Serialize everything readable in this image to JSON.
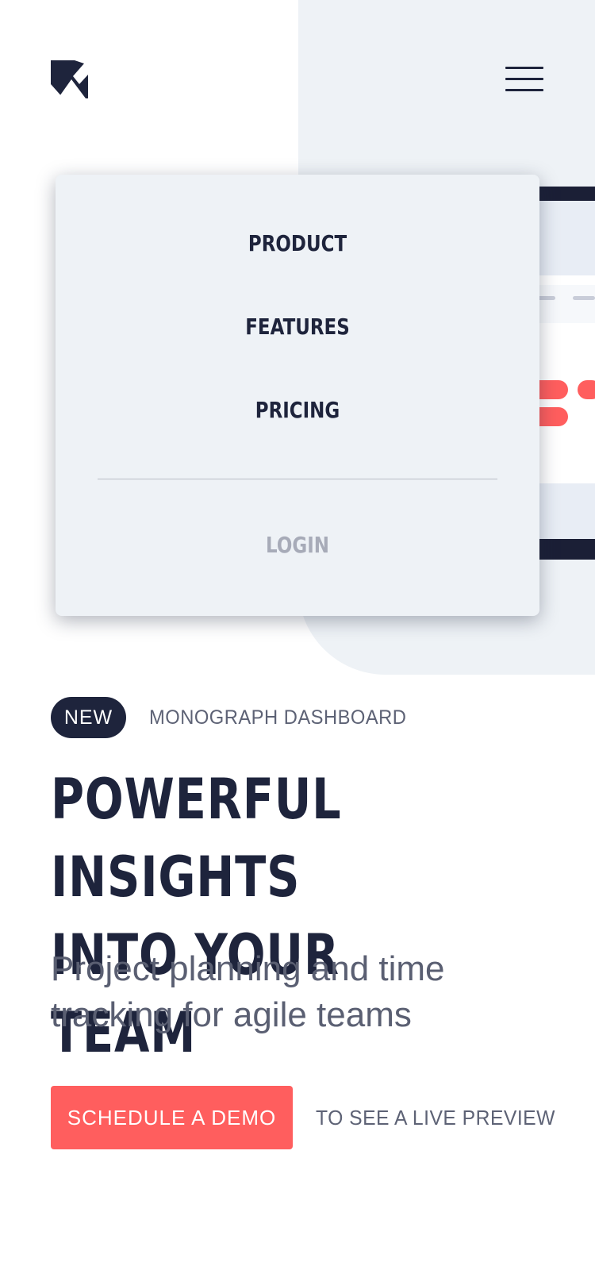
{
  "header": {
    "logo_icon": "k-logo-icon",
    "menu_icon": "hamburger-icon"
  },
  "menu": {
    "items": [
      {
        "label": "PRODUCT"
      },
      {
        "label": "FEATURES"
      },
      {
        "label": "PRICING"
      }
    ],
    "login_label": "LOGIN"
  },
  "hero": {
    "badge": "NEW",
    "badge_caption": "MONOGRAPH DASHBOARD",
    "headline_line1": "POWERFUL INSIGHTS",
    "headline_line2": "INTO YOUR TEAM",
    "subline_line1": "Project planning and time",
    "subline_line2": "tracking for agile teams",
    "cta_label": "SCHEDULE A DEMO",
    "cta_note": "TO SEE A LIVE PREVIEW"
  },
  "colors": {
    "navy": "#1e243c",
    "accent": "#ff5e5e",
    "panel": "#eef2f6",
    "muted": "#a7abb8"
  }
}
